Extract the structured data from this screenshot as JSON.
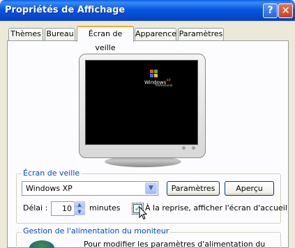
{
  "window": {
    "title": "Propriétés de Affichage",
    "help_label": "?",
    "close_label": "✕"
  },
  "tabs": [
    {
      "label": "Thèmes",
      "active": false
    },
    {
      "label": "Bureau",
      "active": false
    },
    {
      "label": "Écran de veille",
      "active": true
    },
    {
      "label": "Apparence",
      "active": false
    },
    {
      "label": "Paramètres",
      "active": false
    }
  ],
  "preview": {
    "brand_line1": "Windows",
    "brand_line2": "XP",
    "brand_sub": "Professional"
  },
  "screensaver": {
    "group_title": "Écran de veille",
    "selected": "Windows XP",
    "settings_button": "Paramètres",
    "preview_button": "Aperçu",
    "delay_label": "Délai :",
    "delay_value": "10",
    "delay_unit": "minutes",
    "resume_checked": true,
    "resume_label": "À la reprise, afficher l'écran d'accueil"
  },
  "power": {
    "group_title": "Gestion de l'alimentation du moniteur",
    "description": "Pour modifier les paramètres d'alimentation du moniteur et"
  },
  "icons": {
    "help": "help-icon",
    "close": "close-icon",
    "dropdown": "chevron-down-icon",
    "windows_flag": "windows-logo-icon",
    "power": "power-settings-icon",
    "cursor": "mouse-pointer-icon"
  },
  "colors": {
    "title_bar": "#0A5EE8",
    "group_title": "#0046D5",
    "active_tab_highlight": "#F7A93C",
    "dialog_bg": "#ECE9D8"
  }
}
